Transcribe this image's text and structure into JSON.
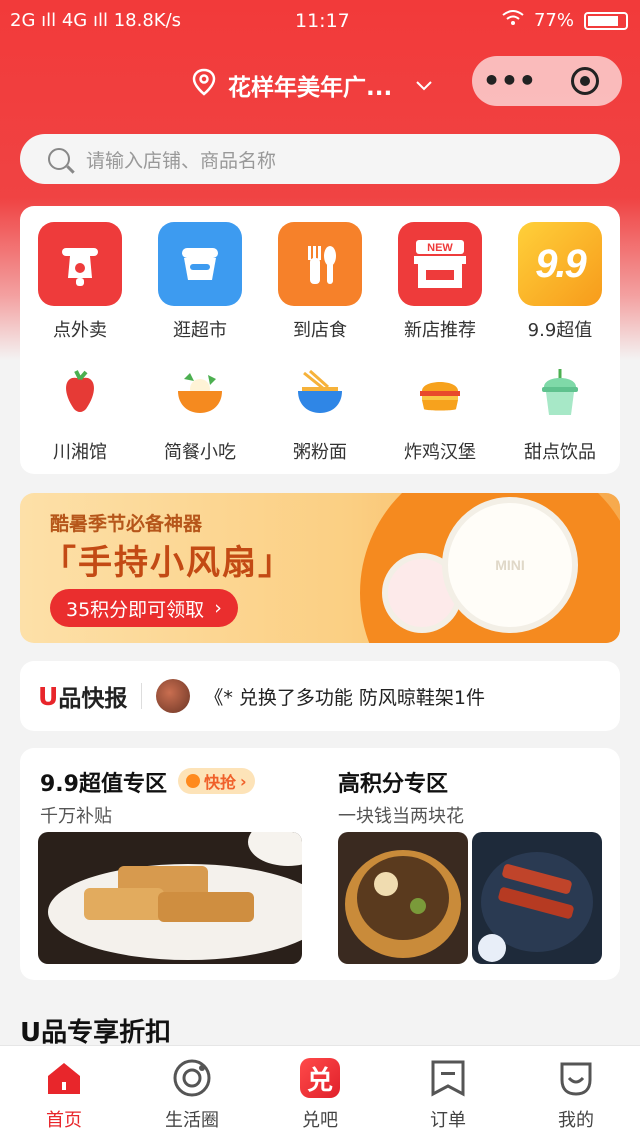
{
  "status_bar": {
    "left": "2G ıll 4G ıll 18.8K/s",
    "time": "11:17",
    "battery": "77%"
  },
  "header": {
    "location": "花样年美年广...",
    "capsule_more": "•••"
  },
  "search": {
    "placeholder": "请输入店铺、商品名称"
  },
  "categories_row1": [
    {
      "label": "点外卖",
      "icon": "scooter-icon",
      "color": "#ee3b3b"
    },
    {
      "label": "逛超市",
      "icon": "basket-icon",
      "color": "#3d9bf0"
    },
    {
      "label": "到店食",
      "icon": "fork-spoon-icon",
      "color": "#f6812a"
    },
    {
      "label": "新店推荐",
      "icon": "new-store-icon",
      "color": "#ee3b3b",
      "badge": "NEW"
    },
    {
      "label": "9.9超值",
      "icon": "nine-nine-icon",
      "color": "#f7a91e",
      "badge": "9.9"
    }
  ],
  "categories_row2": [
    {
      "label": "川湘馆",
      "icon": "chili-icon"
    },
    {
      "label": "简餐小吃",
      "icon": "rice-bowl-icon"
    },
    {
      "label": "粥粉面",
      "icon": "noodle-bowl-icon"
    },
    {
      "label": "炸鸡汉堡",
      "icon": "burger-icon"
    },
    {
      "label": "甜点饮品",
      "icon": "drink-icon"
    }
  ],
  "banner": {
    "subtitle": "酷暑季节必备神器",
    "headline": "「手持小风扇」",
    "cta": "35积分即可领取",
    "cta_arrow": "›",
    "fan_label": "MINI"
  },
  "news": {
    "logo_u": "U",
    "logo_text": "品快报",
    "message": "《* 兑换了多功能 防风晾鞋架1件"
  },
  "zones": {
    "left": {
      "title": "9.9超值专区",
      "tag": "快抢",
      "tag_arrow": "›",
      "subtitle": "千万补贴"
    },
    "right": {
      "title": "高积分专区",
      "subtitle": "一块钱当两块花"
    }
  },
  "section_title": "U品专享折扣",
  "tabbar": [
    {
      "label": "首页",
      "icon": "home-icon",
      "active": true
    },
    {
      "label": "生活圈",
      "icon": "life-circle-icon",
      "active": false
    },
    {
      "label": "兑吧",
      "icon": "exchange-icon",
      "active": false,
      "glyph": "兑"
    },
    {
      "label": "订单",
      "icon": "order-icon",
      "active": false
    },
    {
      "label": "我的",
      "icon": "profile-icon",
      "active": false
    }
  ],
  "colors": {
    "primary": "#ee3b3b",
    "accent": "#e8262b"
  }
}
